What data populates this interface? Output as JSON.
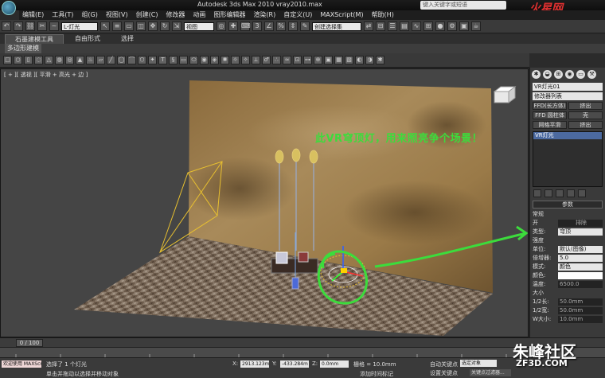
{
  "titlebar": {
    "title": "Autodesk 3ds Max  2010    vray2010.max",
    "search_placeholder": "键入关键字或短语",
    "brand": "火星网"
  },
  "menu": [
    "编辑(E)",
    "工具(T)",
    "组(G)",
    "视图(V)",
    "创建(C)",
    "修改器",
    "动画",
    "图形编辑器",
    "渲染(R)",
    "自定义(U)",
    "MAXScript(M)",
    "帮助(H)"
  ],
  "toolbar": {
    "filter_select": "L-灯光",
    "view_select": "视图",
    "named_selection": "创建选择集"
  },
  "ribbon": {
    "tabs": [
      "石墨建模工具",
      "自由形式",
      "选择"
    ],
    "subpanel": "多边形建模"
  },
  "viewport": {
    "label": "[ + ][ 透视 ][ 平滑 + 高光 + 边 ]",
    "annotation": "此VR穹顶灯，用来照亮争个场景！"
  },
  "command_panel": {
    "object_name": "VR灯光01",
    "modifier_list": "修改器列表",
    "buttons": [
      [
        "FFD(长方体)",
        "挤出"
      ],
      [
        "FFD 圆柱体",
        "壳"
      ],
      [
        "网格平滑",
        "挤出"
      ]
    ],
    "stack_item": "VR灯光",
    "rollout_params": "参数",
    "general_label": "常规",
    "on_label": "开",
    "exclude_btn": "排除",
    "type_label": "类型:",
    "type_value": "穹顶",
    "intensity_label": "强度",
    "unit_label": "单位:",
    "unit_value": "默认(图像)",
    "multiplier_label": "倍增器:",
    "multiplier_value": "5.0",
    "mode_label": "模式:",
    "mode_value": "颜色",
    "color_label": "颜色:",
    "temp_label": "温度:",
    "temp_value": "6500.0",
    "size_label": "大小",
    "half_length_label": "1/2长:",
    "half_length_value": "50.0mm",
    "half_width_label": "1/2宽:",
    "half_width_value": "50.0mm",
    "w_size_label": "W大小:",
    "w_size_value": "10.0mm"
  },
  "timeline": {
    "frame": "0 / 100"
  },
  "status": {
    "maxscript": "欢迎使用 MAXScr",
    "selection": "选择了 1 个灯光",
    "prompt": "单击并拖动以选择并移动对象",
    "x_label": "X:",
    "x_value": "2913.123m",
    "y_label": "Y:",
    "y_value": "-433.284m",
    "z_label": "Z:",
    "z_value": "0.0mm",
    "grid": "栅格 = 10.0mm",
    "add_tag": "添加时间标记",
    "auto_key": "自动关键点",
    "set_key": "设置关键点",
    "selected_object": "选定对象",
    "key_filter": "关键点过滤器..."
  },
  "watermark": {
    "main": "朱峰社区",
    "sub": "ZF3D.COM"
  },
  "colors": {
    "annotation": "#3cdc3c",
    "light_gizmo": "#e8c030",
    "stack_highlight": "#4c6aa0"
  }
}
